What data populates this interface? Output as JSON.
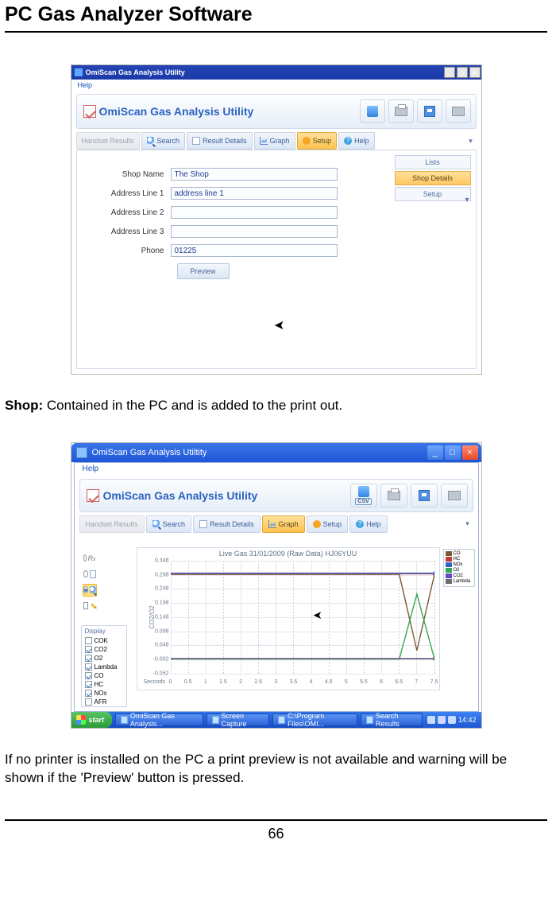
{
  "doc": {
    "title": "PC Gas Analyzer Software",
    "page_number": "66",
    "para_shop": "Contained in the PC and is added to the print out.",
    "para_shop_label": "Shop: ",
    "para_noprinter": "If no printer is installed on the PC a print preview is not available and warning will be shown if the 'Preview' button is pressed."
  },
  "shotA": {
    "window_title": "OmiScan Gas Analysis Utility",
    "menu_help": "Help",
    "brand": "OmiScan Gas Analysis Utility",
    "win": {
      "min": "_",
      "max": "□",
      "close": "×"
    },
    "tabs": {
      "handset": "Handset Results",
      "search": "Search",
      "result": "Result Details",
      "graph": "Graph",
      "setup": "Setup",
      "help": "Help",
      "chev": "▾"
    },
    "side": {
      "lists": "Lists",
      "shop": "Shop Details",
      "setup": "Setup",
      "chev": "▾"
    },
    "form": {
      "shop_name_lbl": "Shop Name",
      "shop_name_val": "The Shop",
      "addr1_lbl": "Address Line 1",
      "addr1_val": "address line 1",
      "addr2_lbl": "Address Line 2",
      "addr2_val": "",
      "addr3_lbl": "Address Line 3",
      "addr3_val": "",
      "phone_lbl": "Phone",
      "phone_val": "01225",
      "preview_btn": "Preview"
    }
  },
  "shotB": {
    "window_title": "OmiScan Gas Analysis Utiltity",
    "menu_help": "Help",
    "brand": "OmiScan Gas Analysis Utility",
    "csv": "CSV",
    "tabs": {
      "handset": "Handset Results",
      "search": "Search",
      "result": "Result Details",
      "graph": "Graph",
      "setup": "Setup",
      "help": "Help",
      "chev": "▾"
    },
    "display": {
      "header": "Display",
      "items": [
        {
          "label": "COK",
          "checked": false
        },
        {
          "label": "CO2",
          "checked": true
        },
        {
          "label": "O2",
          "checked": true
        },
        {
          "label": "Lambda",
          "checked": true
        },
        {
          "label": "CO",
          "checked": true
        },
        {
          "label": "HC",
          "checked": true
        },
        {
          "label": "NOx",
          "checked": true
        },
        {
          "label": "AFR",
          "checked": false
        }
      ]
    },
    "legend": [
      {
        "label": "CO",
        "color": "#7a5a32"
      },
      {
        "label": "HC",
        "color": "#c33a3a"
      },
      {
        "label": "NOx",
        "color": "#2f66c4"
      },
      {
        "label": "O2",
        "color": "#32a852"
      },
      {
        "label": "CO2",
        "color": "#6b45c9"
      },
      {
        "label": "Lambda",
        "color": "#6d6d6d"
      }
    ],
    "taskbar": {
      "start": "start",
      "items": [
        "OmiScan Gas Analysis...",
        "Screen Capture",
        "C:\\Program Files\\OMI...",
        "Search Results"
      ],
      "time": "14:42"
    }
  },
  "chart_data": {
    "type": "line",
    "title": "Live Gas 31/01/2009 (Raw Data) HJ06YUU",
    "xlabel": "Seconds",
    "ylabel": "CO2/O2",
    "xlim": [
      0,
      7.5
    ],
    "ylim": [
      -0.052,
      0.348
    ],
    "xticks": [
      0,
      0.5,
      1,
      1.5,
      2,
      2.5,
      3,
      3.5,
      4,
      4.5,
      5,
      5.5,
      6,
      6.5,
      7,
      7.5
    ],
    "yticks": [
      0.348,
      0.298,
      0.248,
      0.198,
      0.148,
      0.098,
      0.048,
      -0.002,
      -0.052
    ],
    "series": [
      {
        "name": "CO",
        "color": "#7a5a32",
        "y": [
          0.3,
          0.3,
          0.3,
          0.3,
          0.3,
          0.3,
          0.3,
          0.3,
          0.3,
          0.3,
          0.3,
          0.3,
          0.3,
          0.3,
          0.03,
          0.3
        ]
      },
      {
        "name": "HC",
        "color": "#c33a3a",
        "y": [
          0.302,
          0.302,
          0.302,
          0.302,
          0.302,
          0.302,
          0.302,
          0.302,
          0.302,
          0.302,
          0.302,
          0.302,
          0.302,
          0.302,
          0.302,
          0.302
        ]
      },
      {
        "name": "NOx",
        "color": "#2f66c4",
        "y": [
          0.304,
          0.304,
          0.304,
          0.304,
          0.304,
          0.304,
          0.304,
          0.304,
          0.304,
          0.304,
          0.304,
          0.304,
          0.304,
          0.304,
          0.304,
          0.304
        ]
      },
      {
        "name": "O2",
        "color": "#32a852",
        "y": [
          0.0,
          0.0,
          0.0,
          0.0,
          0.0,
          0.0,
          0.0,
          0.0,
          0.0,
          0.0,
          0.0,
          0.0,
          0.0,
          0.0,
          0.23,
          0.0
        ]
      },
      {
        "name": "CO2",
        "color": "#6b45c9",
        "y": [
          0.002,
          0.002,
          0.002,
          0.002,
          0.002,
          0.002,
          0.002,
          0.002,
          0.002,
          0.002,
          0.002,
          0.002,
          0.002,
          0.002,
          0.002,
          0.002
        ]
      },
      {
        "name": "Lambda",
        "color": "#6d6d6d",
        "y": [
          0.001,
          0.001,
          0.001,
          0.001,
          0.001,
          0.001,
          0.001,
          0.001,
          0.001,
          0.001,
          0.001,
          0.001,
          0.001,
          0.001,
          0.001,
          0.001
        ]
      }
    ]
  }
}
